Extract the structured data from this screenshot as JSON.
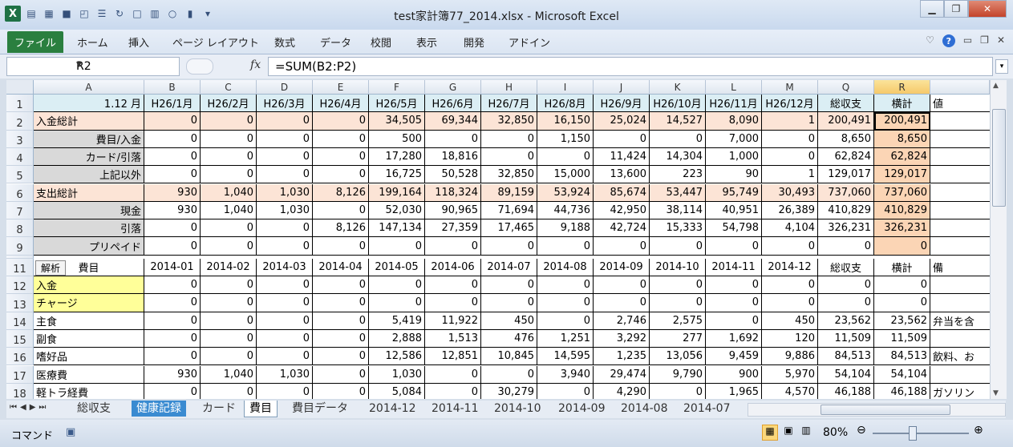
{
  "window": {
    "title": "test家計簿77_2014.xlsx - Microsoft Excel"
  },
  "ribbon": {
    "tabs": [
      "ファイル",
      "ホーム",
      "挿入",
      "ページ レイアウト",
      "数式",
      "データ",
      "校閲",
      "表示",
      "開発",
      "アドイン"
    ]
  },
  "formula_bar": {
    "name_box": "R2",
    "fx": "fx",
    "formula": "=SUM(B2:P2)"
  },
  "columns": [
    "A",
    "B",
    "C",
    "D",
    "E",
    "F",
    "G",
    "H",
    "I",
    "J",
    "K",
    "L",
    "M",
    "Q",
    "R"
  ],
  "rows_top": [
    {
      "rn": "1",
      "cells": [
        "1.12 月",
        "H26/1月",
        "H26/2月",
        "H26/3月",
        "H26/4月",
        "H26/5月",
        "H26/6月",
        "H26/7月",
        "H26/8月",
        "H26/9月",
        "H26/10月",
        "H26/11月",
        "H26/12月",
        "総収支",
        "横計"
      ],
      "extra": "値"
    },
    {
      "rn": "2",
      "cells": [
        "入金総計",
        "0",
        "0",
        "0",
        "0",
        "34,505",
        "69,344",
        "32,850",
        "16,150",
        "25,024",
        "14,527",
        "8,090",
        "1",
        "200,491",
        "200,491"
      ],
      "extra": ""
    },
    {
      "rn": "3",
      "cells": [
        "費目/入金",
        "0",
        "0",
        "0",
        "0",
        "500",
        "0",
        "0",
        "1,150",
        "0",
        "0",
        "7,000",
        "0",
        "8,650",
        "8,650"
      ],
      "extra": ""
    },
    {
      "rn": "4",
      "cells": [
        "カード/引落",
        "0",
        "0",
        "0",
        "0",
        "17,280",
        "18,816",
        "0",
        "0",
        "11,424",
        "14,304",
        "1,000",
        "0",
        "62,824",
        "62,824"
      ],
      "extra": ""
    },
    {
      "rn": "5",
      "cells": [
        "上記以外",
        "0",
        "0",
        "0",
        "0",
        "16,725",
        "50,528",
        "32,850",
        "15,000",
        "13,600",
        "223",
        "90",
        "1",
        "129,017",
        "129,017"
      ],
      "extra": ""
    },
    {
      "rn": "6",
      "cells": [
        "支出総計",
        "930",
        "1,040",
        "1,030",
        "8,126",
        "199,164",
        "118,324",
        "89,159",
        "53,924",
        "85,674",
        "53,447",
        "95,749",
        "30,493",
        "737,060",
        "737,060"
      ],
      "extra": ""
    },
    {
      "rn": "7",
      "cells": [
        "現金",
        "930",
        "1,040",
        "1,030",
        "0",
        "52,030",
        "90,965",
        "71,694",
        "44,736",
        "42,950",
        "38,114",
        "40,951",
        "26,389",
        "410,829",
        "410,829"
      ],
      "extra": ""
    },
    {
      "rn": "8",
      "cells": [
        "引落",
        "0",
        "0",
        "0",
        "8,126",
        "147,134",
        "27,359",
        "17,465",
        "9,188",
        "42,724",
        "15,333",
        "54,798",
        "4,104",
        "326,231",
        "326,231"
      ],
      "extra": ""
    },
    {
      "rn": "9",
      "cells": [
        "プリペイド",
        "0",
        "0",
        "0",
        "0",
        "0",
        "0",
        "0",
        "0",
        "0",
        "0",
        "0",
        "0",
        "0",
        "0"
      ],
      "extra": ""
    }
  ],
  "rows_bottom": [
    {
      "rn": "11",
      "cells": [
        "費目",
        "2014-01",
        "2014-02",
        "2014-03",
        "2014-04",
        "2014-05",
        "2014-06",
        "2014-07",
        "2014-08",
        "2014-09",
        "2014-10",
        "2014-11",
        "2014-12",
        "総収支",
        "横計"
      ],
      "extra": "備"
    },
    {
      "rn": "12",
      "cells": [
        "入金",
        "0",
        "0",
        "0",
        "0",
        "0",
        "0",
        "0",
        "0",
        "0",
        "0",
        "0",
        "0",
        "0",
        "0"
      ],
      "extra": ""
    },
    {
      "rn": "13",
      "cells": [
        "チャージ",
        "0",
        "0",
        "0",
        "0",
        "0",
        "0",
        "0",
        "0",
        "0",
        "0",
        "0",
        "0",
        "0",
        "0"
      ],
      "extra": ""
    },
    {
      "rn": "14",
      "cells": [
        "主食",
        "0",
        "0",
        "0",
        "0",
        "5,419",
        "11,922",
        "450",
        "0",
        "2,746",
        "2,575",
        "0",
        "450",
        "23,562",
        "23,562"
      ],
      "extra": "弁当を含"
    },
    {
      "rn": "15",
      "cells": [
        "副食",
        "0",
        "0",
        "0",
        "0",
        "2,888",
        "1,513",
        "476",
        "1,251",
        "3,292",
        "277",
        "1,692",
        "120",
        "11,509",
        "11,509"
      ],
      "extra": ""
    },
    {
      "rn": "16",
      "cells": [
        "嗜好品",
        "0",
        "0",
        "0",
        "0",
        "12,586",
        "12,851",
        "10,845",
        "14,595",
        "1,235",
        "13,056",
        "9,459",
        "9,886",
        "84,513",
        "84,513"
      ],
      "extra": "飲料、お"
    },
    {
      "rn": "17",
      "cells": [
        "医療費",
        "930",
        "1,040",
        "1,030",
        "0",
        "1,030",
        "0",
        "0",
        "3,940",
        "29,474",
        "9,790",
        "900",
        "5,970",
        "54,104",
        "54,104"
      ],
      "extra": ""
    },
    {
      "rn": "18",
      "cells": [
        "軽トラ経費",
        "0",
        "0",
        "0",
        "0",
        "5,084",
        "0",
        "30,279",
        "0",
        "4,290",
        "0",
        "1,965",
        "4,570",
        "46,188",
        "46,188"
      ],
      "extra": "ガソリン"
    }
  ],
  "a11_label": "解析",
  "sheet_tabs": [
    "総収支",
    "健康記録",
    "カード",
    "費目",
    "費目データ",
    "2014-12",
    "2014-11",
    "2014-10",
    "2014-09",
    "2014-08",
    "2014-07"
  ],
  "status": {
    "mode": "コマンド",
    "zoom": "80%"
  }
}
